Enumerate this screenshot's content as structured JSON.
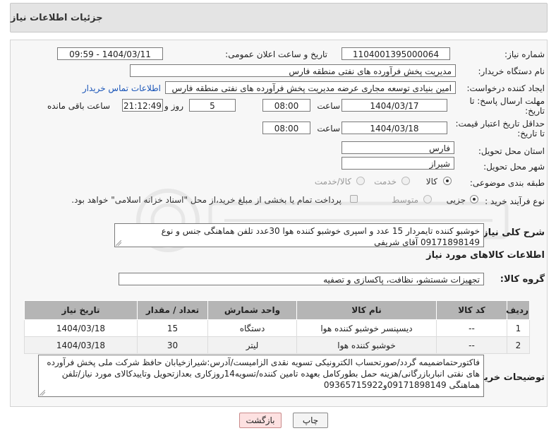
{
  "header": {
    "title": "جزئیات اطلاعات نیاز"
  },
  "form": {
    "need_number": {
      "label": "شماره نیاز:",
      "value": "1104001395000064"
    },
    "announce_datetime": {
      "label": "تاریخ و ساعت اعلان عمومی:",
      "value": "1404/03/11 - 09:59"
    },
    "buyer_org": {
      "label": "نام دستگاه خریدار:",
      "value": "مدیریت پخش فرآورده های نفتی منطقه فارس"
    },
    "requester": {
      "label": "ایجاد کننده درخواست:",
      "value": "امین بنیادی توسعه مجاری عرضه مدیریت پخش فرآورده های نفتی منطقه فارس",
      "contact_link": "اطلاعات تماس خریدار"
    },
    "reply_deadline": {
      "label_line1": "مهلت ارسال پاسخ: تا",
      "label_line2": "تاریخ:",
      "date": "1404/03/17",
      "time_label": "ساعت",
      "time": "08:00",
      "days": "5",
      "days_label": "روز و",
      "remaining": "21:12:49",
      "remaining_label": "ساعت باقی مانده"
    },
    "price_validity": {
      "label_line1": "حداقل تاریخ اعتبار قیمت:",
      "label_line2": "تا تاریخ:",
      "date": "1404/03/18",
      "time_label": "ساعت",
      "time": "08:00"
    },
    "province": {
      "label": "استان محل تحویل:",
      "value": "فارس"
    },
    "city": {
      "label": "شهر محل تحویل:",
      "value": "شیراز"
    },
    "category": {
      "label": "طبقه بندی موضوعی:",
      "options": [
        "کالا",
        "خدمت",
        "کالا/خدمت"
      ],
      "selected": "کالا"
    },
    "purchase_type": {
      "label": "نوع فرآیند خرید :",
      "options": [
        "جزیی",
        "متوسط"
      ],
      "selected": "جزیی",
      "payment_note": "پرداخت تمام یا بخشی از مبلغ خرید،از محل \"اسناد خزانه اسلامی\" خواهد بود."
    },
    "overall_desc": {
      "label": "شرح کلی نیاز:",
      "value": "خوشبو کننده تایمردار 15 عدد و اسپری خوشبو کننده هوا 30عدد تلفن هماهنگی جنس و نوع 09171898149 آقای شریفی"
    }
  },
  "goods_section": {
    "title": "اطلاعات کالاهای مورد نیاز"
  },
  "goods_group": {
    "label": "گروه کالا:",
    "value": "تجهیزات شستشو، نظافت، پاکسازی و تصفیه"
  },
  "table": {
    "headers": [
      "ردیف",
      "کد کالا",
      "نام کالا",
      "واحد شمارش",
      "تعداد / مقدار",
      "تاریخ نیاز"
    ],
    "rows": [
      [
        "1",
        "--",
        "دیسپنسر خوشبو کننده هوا",
        "دستگاه",
        "15",
        "1404/03/18"
      ],
      [
        "2",
        "--",
        "خوشبو کننده هوا",
        "لیتر",
        "30",
        "1404/03/18"
      ]
    ]
  },
  "buyer_notes": {
    "label": "توضیحات خریدار:",
    "value": "فاکتورحتماضمیمه گردد/صورتحساب الکترونیکی تسویه نقدی الزامیست/آدرس:شیرازخیابان حافظ شرکت ملی پخش فرآورده های نفتی انباربازرگانی/هزینه حمل بطورکامل بعهده تامین کننده/تسویه14روزکاری بعدازتحویل وتاییدکالای مورد نیاز/تلفن هماهنگی 09171898149و09365715922"
  },
  "buttons": {
    "print": "چاپ",
    "back": "بازگشت"
  },
  "watermark": {
    "text": "AriaTender.net"
  }
}
